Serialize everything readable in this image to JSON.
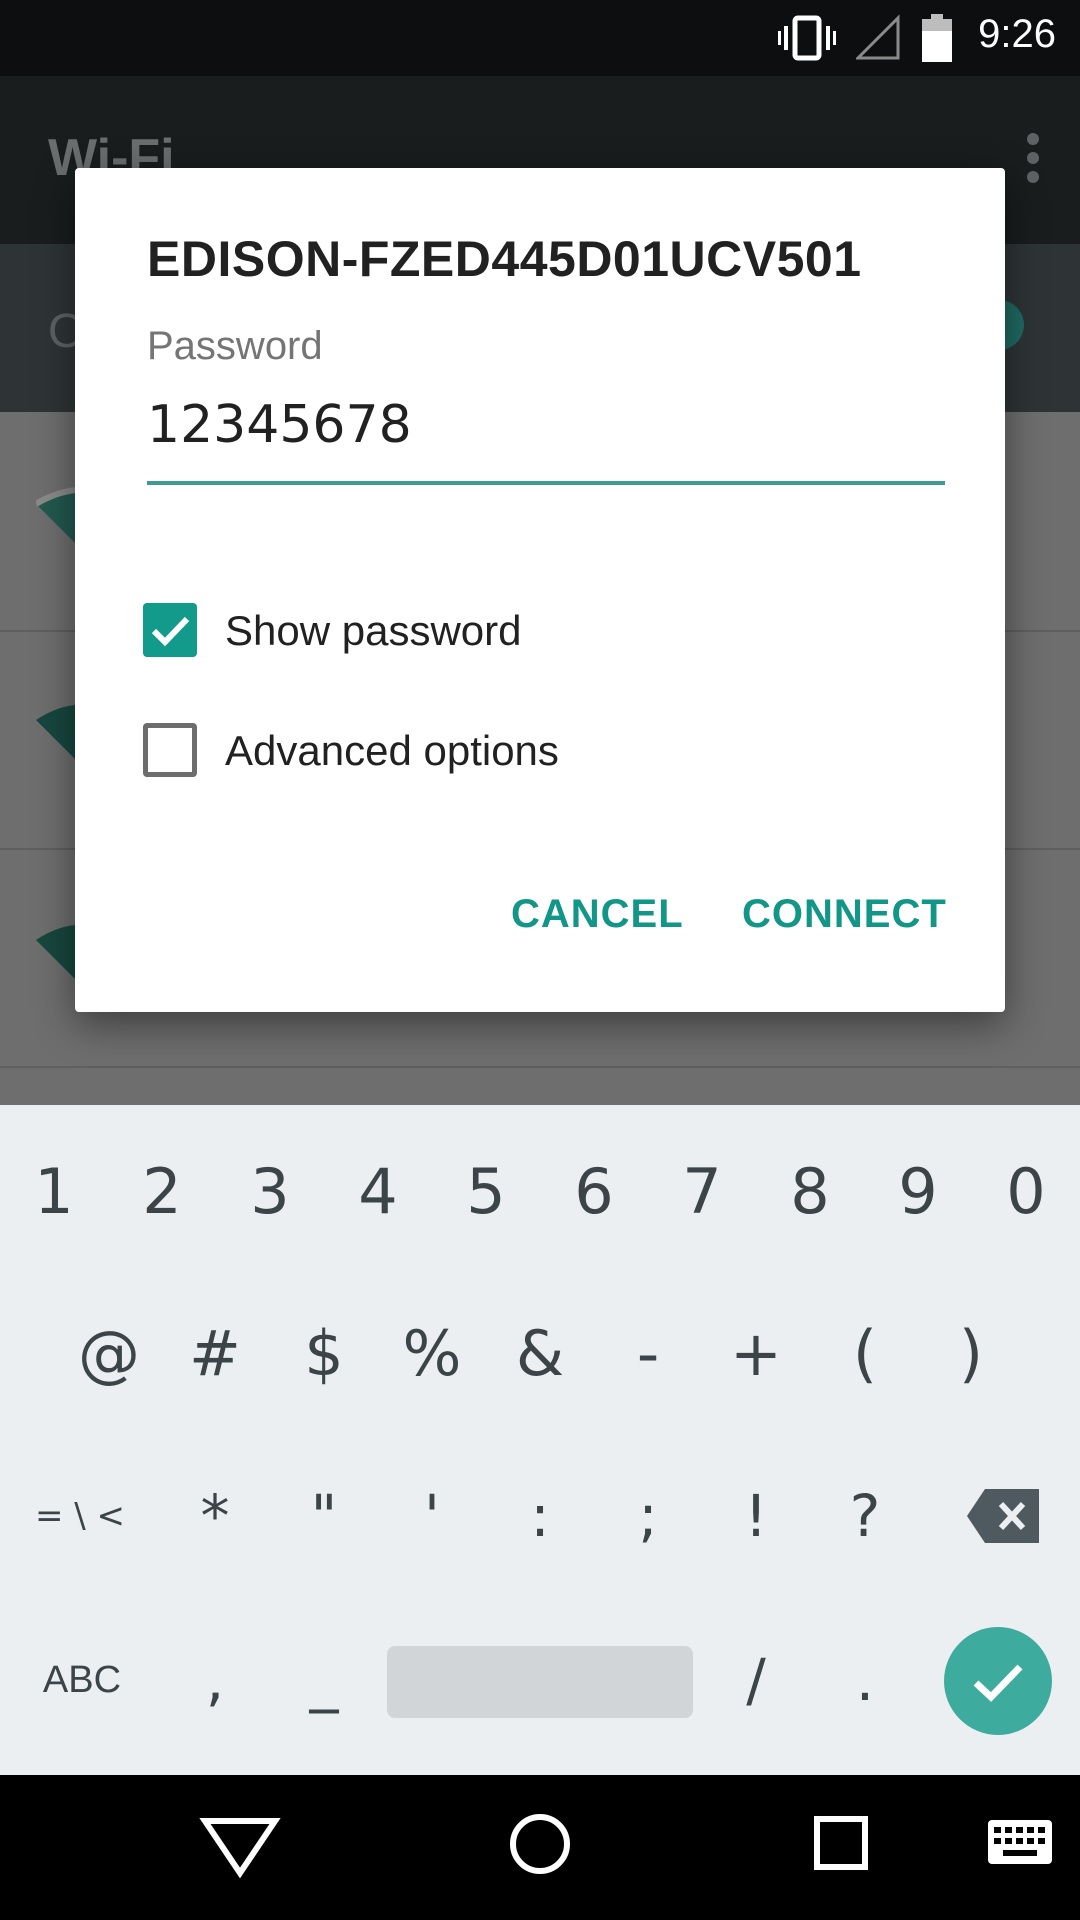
{
  "status_bar": {
    "time": "9:26",
    "icons": [
      "vibrate-icon",
      "cell-signal-icon",
      "battery-icon"
    ]
  },
  "app": {
    "title": "Wi-Fi",
    "switch_label": "O"
  },
  "dialog": {
    "title": "EDISON-FZED445D01UCV501",
    "password_label": "Password",
    "password_value": "12345678",
    "show_password": {
      "label": "Show password",
      "checked": true
    },
    "advanced_options": {
      "label": "Advanced options",
      "checked": false
    },
    "cancel_label": "CANCEL",
    "connect_label": "CONNECT"
  },
  "keyboard": {
    "row1": [
      "1",
      "2",
      "3",
      "4",
      "5",
      "6",
      "7",
      "8",
      "9",
      "0"
    ],
    "row2": [
      "@",
      "#",
      "$",
      "%",
      "&",
      "-",
      "+",
      "(",
      ")"
    ],
    "row3": [
      "= \\ <",
      "*",
      "\"",
      "'",
      ":",
      ";",
      "!",
      "?"
    ],
    "row4": [
      "ABC",
      ",",
      "_",
      "/",
      "."
    ],
    "icons": [
      "backspace-icon",
      "checkmark-icon"
    ]
  },
  "nav_bar": {
    "icons": [
      "back-triangle-icon",
      "home-circle-icon",
      "recents-square-icon",
      "keyboard-icon"
    ]
  },
  "colors": {
    "accent": "#129687",
    "enter_key": "#3eab9f",
    "keyboard_bg": "#eceff1"
  }
}
